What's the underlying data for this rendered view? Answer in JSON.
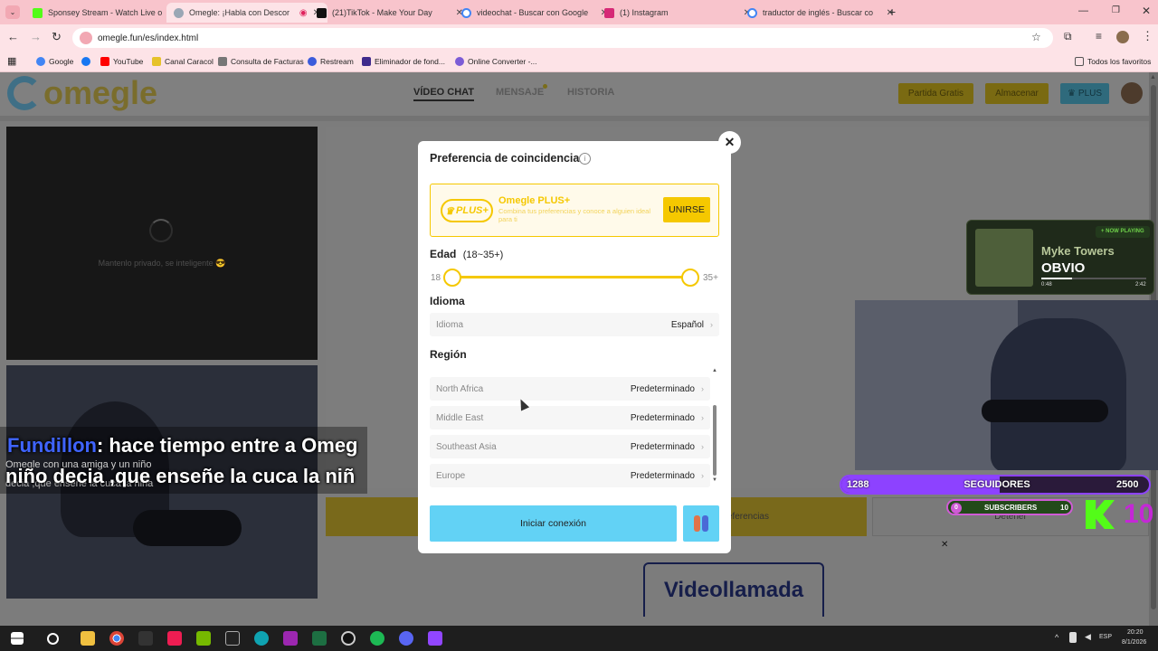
{
  "tabs": [
    {
      "title": "Sponsey Stream - Watch Live o",
      "color": "#53fc18",
      "active": false
    },
    {
      "title": "Omegle: ¡Habla con Descor",
      "color": "#e8a3ad",
      "active": true
    },
    {
      "title": "(21)TikTok - Make Your Day",
      "color": "#111111",
      "active": false
    },
    {
      "title": "videochat - Buscar con Google",
      "color": "#4285f4",
      "active": false
    },
    {
      "title": "(1) Instagram",
      "color": "#d62976",
      "active": false
    },
    {
      "title": "traductor de inglés - Buscar co",
      "color": "#4285f4",
      "active": false
    }
  ],
  "omnibox": {
    "url": "omegle.fun/es/index.html"
  },
  "bookmarks": [
    {
      "label": "Google",
      "color": "#4285f4"
    },
    {
      "label": "YouTube",
      "color": "#ff0000"
    },
    {
      "label": "Canal Caracol",
      "color": "#e6c229"
    },
    {
      "label": "Consulta de Facturas",
      "color": "#777777"
    },
    {
      "label": "Restream",
      "color": "#3b5bdb"
    },
    {
      "label": "Eliminador de fond...",
      "color": "#3f2a8c"
    },
    {
      "label": "Online Converter -...",
      "color": "#7c5cd6"
    }
  ],
  "bookmarks_all": "Todos los favoritos",
  "site": {
    "logo": "omegle",
    "nav": [
      "VÍDEO CHAT",
      "MENSAJE",
      "HISTORIA"
    ],
    "btn_free": "Partida Gratis",
    "btn_store": "Almacenar",
    "btn_plus": "PLUS",
    "privacy_note": "Mantenlo privado, se inteligente 😎",
    "btn_preferences": "Preferencias",
    "btn_stop": "Detener",
    "videocall": "Videollamada"
  },
  "modal": {
    "title": "Preferencia de coincidencia",
    "plus_badge": "PLUS+",
    "plus_title": "Omegle PLUS+",
    "plus_desc": "Combina tus preferencias y conoce a alguien ideal para ti",
    "join_btn": "UNIRSE",
    "age_label": "Edad",
    "age_range": "(18~35+)",
    "age_min": "18",
    "age_max": "35+",
    "age_selected_min_fraction": 0,
    "age_selected_max_fraction": 1,
    "language_label": "Idioma",
    "language_key": "Idioma",
    "language_value": "Español",
    "region_label": "Región",
    "regions": [
      {
        "name": "North Africa",
        "value": "Predeterminado"
      },
      {
        "name": "Middle East",
        "value": "Predeterminado"
      },
      {
        "name": "Southeast Asia",
        "value": "Predeterminado"
      },
      {
        "name": "Europe",
        "value": "Predeterminado"
      }
    ],
    "start_btn": "Iniciar conexión",
    "accent": "#f5c800",
    "start_color": "#62d2f5"
  },
  "overlay": {
    "chat_user": "Fundillon",
    "chat_line1": ": hace tiempo entre a Omeg",
    "chat_line2": "niño decia ,que enseñe la cuca la niñ",
    "chat_small1": "Omegle con una amiga y un niño",
    "chat_small2": "decia ,que enseñe la cuca la niña",
    "now_playing": "NOW PLAYING",
    "artist": "Myke Towers",
    "song": "OBVIO",
    "time_elapsed": "0:48",
    "time_total": "2:42",
    "followers_count": "1288",
    "followers_label": "SEGUIDORES",
    "followers_goal": "2500",
    "subs_count": "0",
    "subs_label": "SUBSCRIBERS",
    "subs_goal": "10",
    "kick_num": "10"
  },
  "taskbar": {
    "lang": "ESP",
    "time": "20:20",
    "date": "8/1/2026"
  }
}
